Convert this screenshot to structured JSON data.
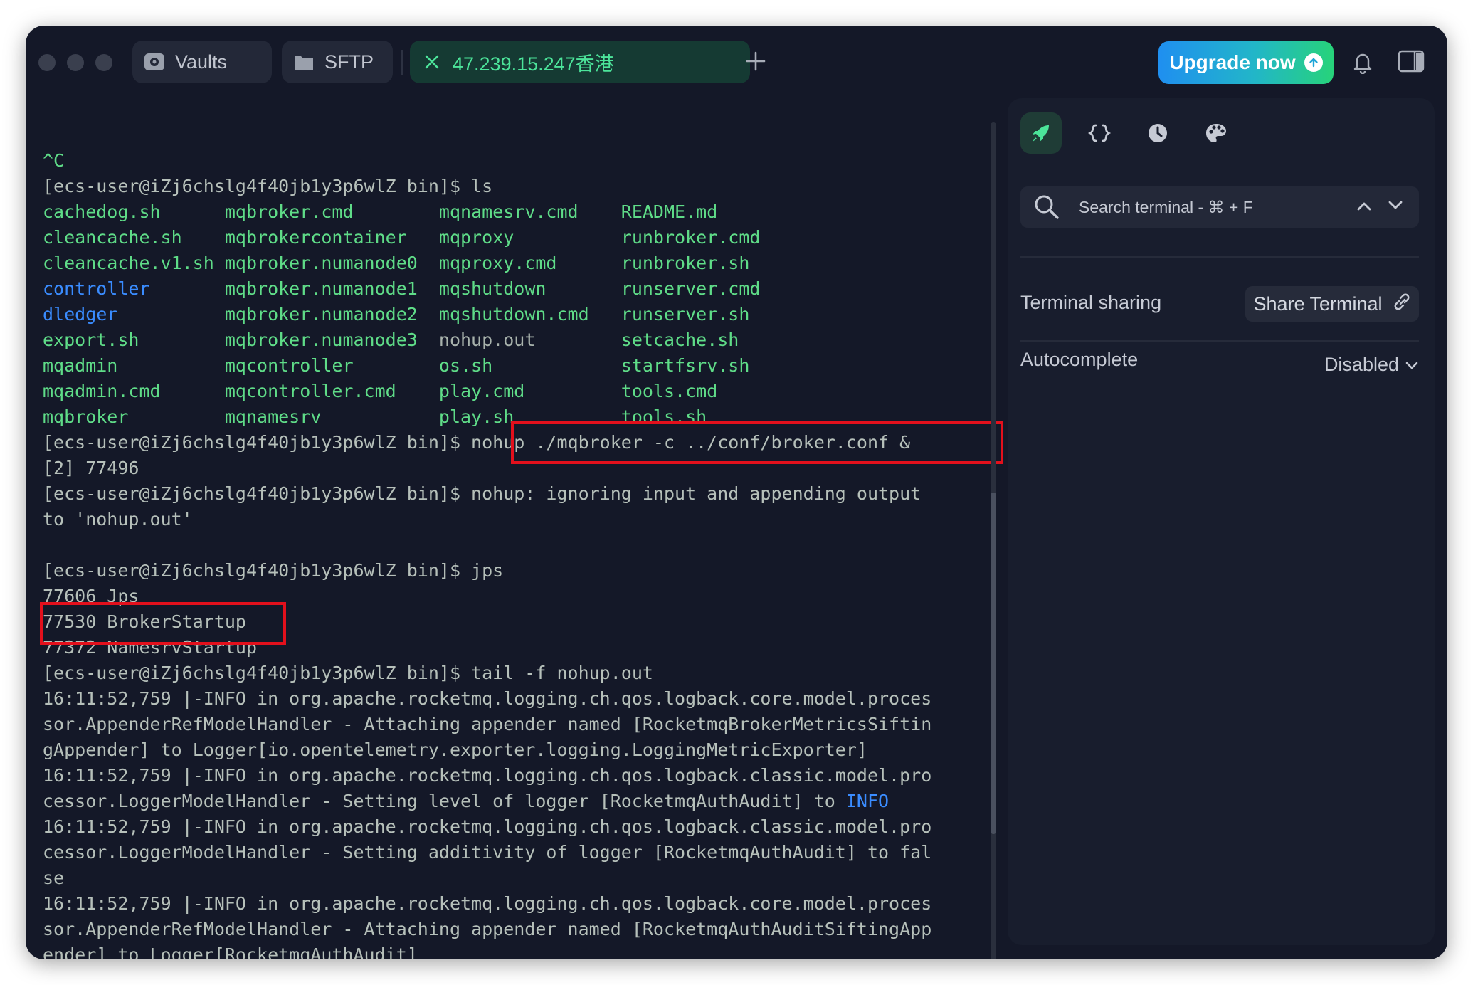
{
  "titlebar": {
    "tabs": [
      {
        "label": "Vaults",
        "icon": "vault-icon"
      },
      {
        "label": "SFTP",
        "icon": "folder-icon"
      },
      {
        "label": "47.239.15.247香港",
        "icon": "close-icon",
        "active": true
      }
    ],
    "new_tab_icon": "plus-icon",
    "upgrade_label": "Upgrade now",
    "notification_icon": "bell-icon",
    "panel_icon": "sidebar-toggle-icon"
  },
  "terminal": {
    "lines": [
      [
        {
          "t": "^C",
          "c": "g"
        }
      ],
      [
        {
          "t": "[ecs-user@iZj6chslg4f40jb1y3p6wlZ bin]$ ls",
          "c": "p"
        }
      ],
      [
        {
          "t": "cachedog.sh      ",
          "c": "g"
        },
        {
          "t": "mqbroker.cmd        ",
          "c": "g"
        },
        {
          "t": "mqnamesrv.cmd    ",
          "c": "g"
        },
        {
          "t": "README.md",
          "c": "g"
        }
      ],
      [
        {
          "t": "cleancache.sh    ",
          "c": "g"
        },
        {
          "t": "mqbrokercontainer   ",
          "c": "g"
        },
        {
          "t": "mqproxy          ",
          "c": "g"
        },
        {
          "t": "runbroker.cmd",
          "c": "g"
        }
      ],
      [
        {
          "t": "cleancache.v1.sh ",
          "c": "g"
        },
        {
          "t": "mqbroker.numanode0  ",
          "c": "g"
        },
        {
          "t": "mqproxy.cmd      ",
          "c": "g"
        },
        {
          "t": "runbroker.sh",
          "c": "g"
        }
      ],
      [
        {
          "t": "controller       ",
          "c": "b"
        },
        {
          "t": "mqbroker.numanode1  ",
          "c": "g"
        },
        {
          "t": "mqshutdown       ",
          "c": "g"
        },
        {
          "t": "runserver.cmd",
          "c": "g"
        }
      ],
      [
        {
          "t": "dledger          ",
          "c": "b"
        },
        {
          "t": "mqbroker.numanode2  ",
          "c": "g"
        },
        {
          "t": "mqshutdown.cmd   ",
          "c": "g"
        },
        {
          "t": "runserver.sh",
          "c": "g"
        }
      ],
      [
        {
          "t": "export.sh        ",
          "c": "g"
        },
        {
          "t": "mqbroker.numanode3  ",
          "c": "g"
        },
        {
          "t": "nohup.out        ",
          "c": "w"
        },
        {
          "t": "setcache.sh",
          "c": "g"
        }
      ],
      [
        {
          "t": "mqadmin          ",
          "c": "g"
        },
        {
          "t": "mqcontroller        ",
          "c": "g"
        },
        {
          "t": "os.sh            ",
          "c": "g"
        },
        {
          "t": "startfsrv.sh",
          "c": "g"
        }
      ],
      [
        {
          "t": "mqadmin.cmd      ",
          "c": "g"
        },
        {
          "t": "mqcontroller.cmd    ",
          "c": "g"
        },
        {
          "t": "play.cmd         ",
          "c": "g"
        },
        {
          "t": "tools.cmd",
          "c": "g"
        }
      ],
      [
        {
          "t": "mqbroker         ",
          "c": "g"
        },
        {
          "t": "mqnamesrv           ",
          "c": "g"
        },
        {
          "t": "play.sh          ",
          "c": "g"
        },
        {
          "t": "tools.sh",
          "c": "g"
        }
      ],
      [
        {
          "t": "[ecs-user@iZj6chslg4f40jb1y3p6wlZ bin]$ nohup ./mqbroker -c ../conf/broker.conf &",
          "c": "p"
        }
      ],
      [
        {
          "t": "[2] 77496",
          "c": "p"
        }
      ],
      [
        {
          "t": "[ecs-user@iZj6chslg4f40jb1y3p6wlZ bin]$ nohup: ignoring input and appending output",
          "c": "p"
        }
      ],
      [
        {
          "t": "to 'nohup.out'",
          "c": "p"
        }
      ],
      [
        {
          "t": "",
          "c": "p"
        }
      ],
      [
        {
          "t": "[ecs-user@iZj6chslg4f40jb1y3p6wlZ bin]$ jps",
          "c": "p"
        }
      ],
      [
        {
          "t": "77606 Jps",
          "c": "p"
        }
      ],
      [
        {
          "t": "77530 BrokerStartup",
          "c": "p"
        }
      ],
      [
        {
          "t": "77372 NamesrvStartup",
          "c": "p"
        }
      ],
      [
        {
          "t": "[ecs-user@iZj6chslg4f40jb1y3p6wlZ bin]$ tail -f nohup.out",
          "c": "p"
        }
      ],
      [
        {
          "t": "16:11:52,759 |-INFO in org.apache.rocketmq.logging.ch.qos.logback.core.model.proces",
          "c": "p"
        }
      ],
      [
        {
          "t": "sor.AppenderRefModelHandler - Attaching appender named [RocketmqBrokerMetricsSiftin",
          "c": "p"
        }
      ],
      [
        {
          "t": "gAppender] to Logger[io.opentelemetry.exporter.logging.LoggingMetricExporter]",
          "c": "p"
        }
      ],
      [
        {
          "t": "16:11:52,759 |-INFO in org.apache.rocketmq.logging.ch.qos.logback.classic.model.pro",
          "c": "p"
        }
      ],
      [
        {
          "t": "cessor.LoggerModelHandler - Setting level of logger [RocketmqAuthAudit] to ",
          "c": "p"
        },
        {
          "t": "INFO",
          "c": "b"
        }
      ],
      [
        {
          "t": "16:11:52,759 |-INFO in org.apache.rocketmq.logging.ch.qos.logback.classic.model.pro",
          "c": "p"
        }
      ],
      [
        {
          "t": "cessor.LoggerModelHandler - Setting additivity of logger [RocketmqAuthAudit] to fal",
          "c": "p"
        }
      ],
      [
        {
          "t": "se",
          "c": "p"
        }
      ],
      [
        {
          "t": "16:11:52,759 |-INFO in org.apache.rocketmq.logging.ch.qos.logback.core.model.proces",
          "c": "p"
        }
      ],
      [
        {
          "t": "sor.AppenderRefModelHandler - Attaching appender named [RocketmqAuthAuditSiftingApp",
          "c": "p"
        }
      ],
      [
        {
          "t": "ender] to Logger[RocketmqAuthAudit]",
          "c": "p"
        }
      ]
    ],
    "colors": {
      "prompt": "#b6c0ba",
      "file": "#5fdc88",
      "dir": "#3a8cff",
      "highlight": "#e3101c"
    }
  },
  "sidepanel": {
    "tabs": [
      "rocket-icon",
      "braces-icon",
      "history-icon",
      "palette-icon"
    ],
    "search_placeholder": "Search terminal - ⌘ + F",
    "terminal_sharing_label": "Terminal sharing",
    "share_button_label": "Share Terminal",
    "autocomplete_label": "Autocomplete",
    "autocomplete_value": "Disabled"
  }
}
